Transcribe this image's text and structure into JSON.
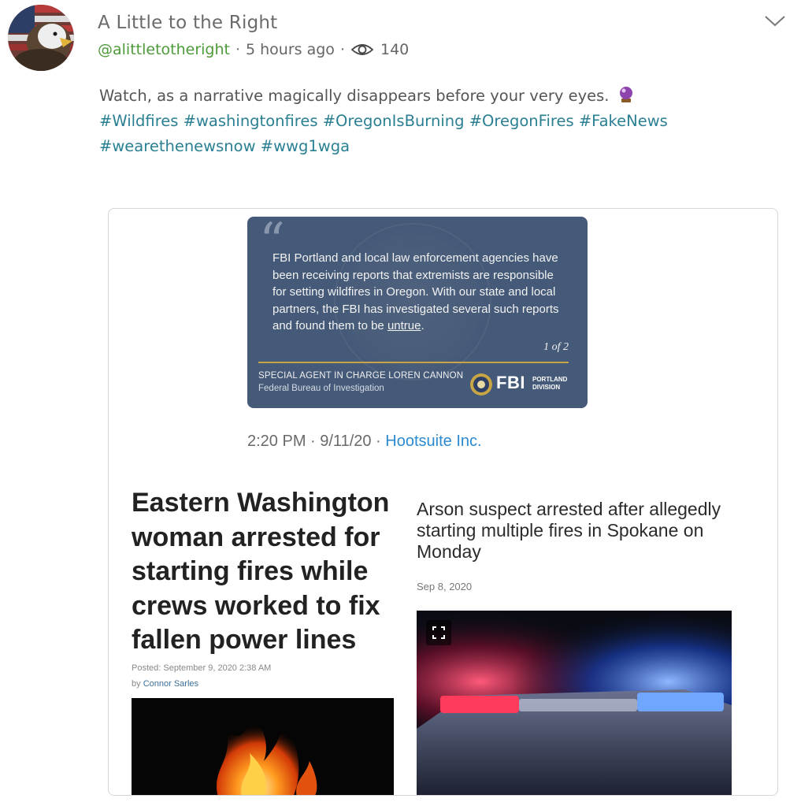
{
  "post": {
    "author_name": "A Little to the Right",
    "handle": "@alittletotheright",
    "separator": "·",
    "time": "5 hours ago",
    "views": "140",
    "text": "Watch, as a narrative magically disappears before your very eyes.",
    "hashtags_line1": [
      "#Wildfires",
      "#washingtonfires",
      "#OregonIsBurning",
      "#OregonFires",
      "#FakeNews"
    ],
    "hashtags_line2": [
      "#wearethenewsnow",
      "#wwg1wga"
    ]
  },
  "icons": {
    "avatar": "eagle-flag-avatar",
    "views": "eye-icon",
    "menu": "chevron-down-icon",
    "emoji": "crystal-ball-icon",
    "expand": "expand-icon"
  },
  "embed": {
    "fbi_card": {
      "quote_pre": "FBI Portland and local law enforcement agencies have been receiving reports that extremists are responsible for setting wildfires in Oregon. With our state and local partners, the FBI has investigated several such reports and found them to be ",
      "quote_link": "untrue",
      "quote_post": ".",
      "page": "1 of 2",
      "agent": "SPECIAL AGENT IN CHARGE LOREN CANNON",
      "bureau": "Federal Bureau of Investigation",
      "logo": "FBI",
      "division_line1": "PORTLAND",
      "division_line2": "DIVISION"
    },
    "tweet_time": "2:20 PM · 9/11/20 · ",
    "tweet_source": "Hootsuite Inc.",
    "article_left": {
      "headline": "Eastern Washington woman arrested for starting fires while crews worked to fix fallen power lines",
      "posted": "Posted:  September 9, 2020 2:38 AM",
      "by": "by ",
      "author": "Connor Sarles"
    },
    "article_right": {
      "headline": "Arson suspect arrested after allegedly starting multiple fires in Spokane on Monday",
      "date": "Sep 8, 2020"
    }
  },
  "colors": {
    "handle": "#4e9a3a",
    "hashtag": "#2a7f93",
    "fbi_panel": "#455a78",
    "fbi_rule": "#c7a445",
    "source_link": "#2b8ad0"
  }
}
